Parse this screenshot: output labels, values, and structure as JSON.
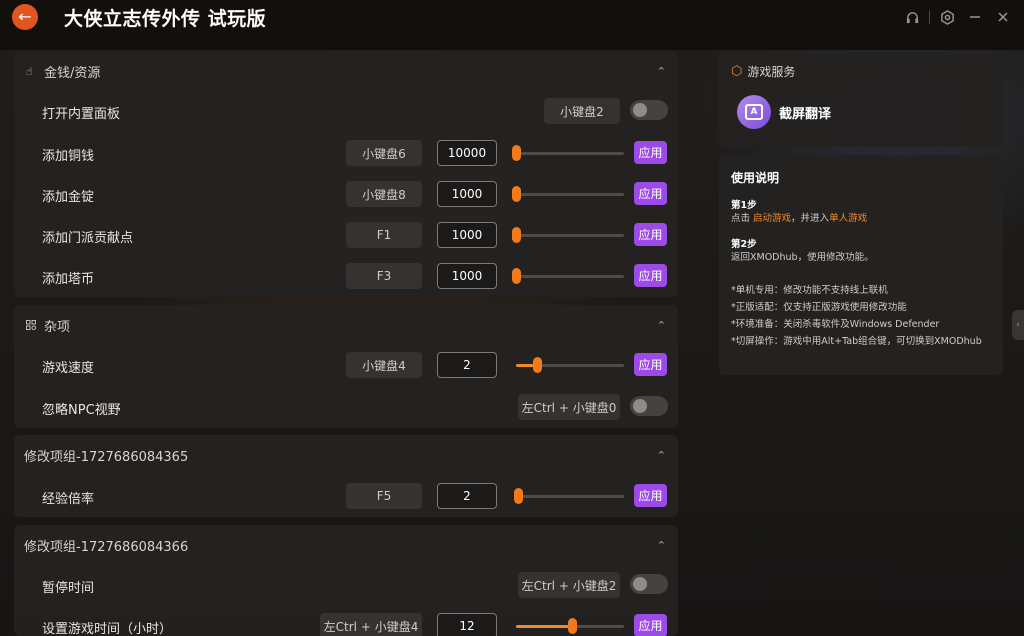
{
  "app": {
    "title": "大侠立志传外传 试玩版",
    "back_icon": "arrow-left-icon",
    "accent_color": "#e0561e"
  },
  "window_controls": [
    "headset-icon",
    "settings-icon",
    "minimize-icon",
    "close-icon"
  ],
  "sections": [
    {
      "title": "金钱/资源",
      "icon": "hand-icon",
      "rows": [
        {
          "label": "打开内置面板",
          "key": "小键盘2",
          "type": "toggle",
          "on": false
        },
        {
          "label": "添加铜钱",
          "key": "小键盘6",
          "type": "slider",
          "value": "10000",
          "level": 0
        },
        {
          "label": "添加金锭",
          "key": "小键盘8",
          "type": "slider",
          "value": "1000",
          "level": 0
        },
        {
          "label": "添加门派贡献点",
          "key": "F1",
          "type": "slider",
          "value": "1000",
          "level": 0
        },
        {
          "label": "添加塔币",
          "key": "F3",
          "type": "slider",
          "value": "1000",
          "level": 0
        }
      ]
    },
    {
      "title": "杂项",
      "icon": "grid-icon",
      "rows": [
        {
          "label": "游戏速度",
          "key": "小键盘4",
          "type": "slider",
          "value": "2",
          "level": 0.2
        },
        {
          "label": "忽略NPC视野",
          "key": "左Ctrl + 小键盘0",
          "type": "toggle",
          "on": false
        }
      ]
    },
    {
      "title": "修改项组-1727686084365",
      "rows": [
        {
          "label": "经验倍率",
          "key": "F5",
          "type": "slider",
          "value": "2",
          "level": 0.02
        }
      ]
    },
    {
      "title": "修改项组-1727686084366",
      "rows": [
        {
          "label": "暂停时间",
          "key": "左Ctrl + 小键盘2",
          "type": "toggle",
          "on": false
        },
        {
          "label": "设置游戏时间（小时）",
          "key": "左Ctrl + 小键盘4",
          "type": "slider",
          "value": "12",
          "level": 0.5
        }
      ]
    }
  ],
  "apply_label": "应用",
  "apply_color": "#9d4be8",
  "slider_color": "#f27a1a",
  "service": {
    "title": "游戏服务",
    "item_label": "截屏翻译"
  },
  "help": {
    "title": "使用说明",
    "step1_title": "第1步",
    "step1_a": "点击 ",
    "step1_link1": "启动游戏",
    "step1_b": "，并进入",
    "step1_link2": "单人游戏",
    "step2_title": "第2步",
    "step2_text": "返回XMODhub，使用修改功能。",
    "notes": [
      "*单机专用：修改功能不支持线上联机",
      "*正版适配：仅支持正版游戏使用修改功能",
      "*环境准备：关闭杀毒软件及Windows Defender",
      "*切屏操作：游戏中用Alt+Tab组合键，可切换到XMODhub"
    ]
  }
}
